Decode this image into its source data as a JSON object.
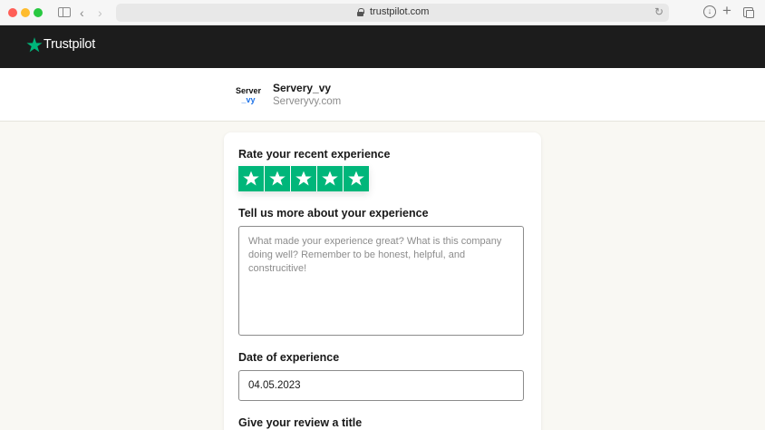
{
  "browser": {
    "url": "trustpilot.com"
  },
  "header": {
    "logo_text": "Trustpilot",
    "brand_color": "#00b67a"
  },
  "business": {
    "logo_line1": "Server",
    "logo_line2": "_vy",
    "name": "Servery_vy",
    "domain": "Serveryvy.com"
  },
  "review_form": {
    "rating_label": "Rate your recent experience",
    "rating_value": 5,
    "rating_max": 5,
    "experience_label": "Tell us more about your experience",
    "experience_placeholder": "What made your experience great? What is this company doing well? Remember to be honest, helpful, and construcitive!",
    "date_label": "Date of experience",
    "date_value": "04.05.2023",
    "title_label": "Give your review a title"
  }
}
